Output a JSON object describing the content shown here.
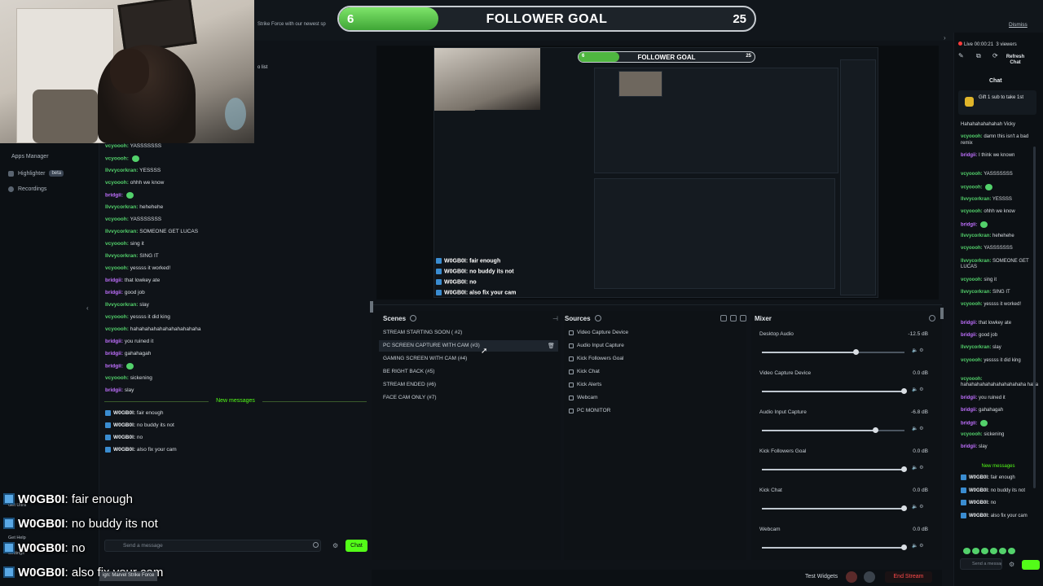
{
  "goal": {
    "current": "6",
    "title": "FOLLOWER GOAL",
    "target": "25",
    "progress": 0.24
  },
  "top": {
    "banner_text": "Strike Force with our newest sp",
    "dismiss": "Dismiss",
    "scene_snippet": "o list"
  },
  "sidebar": {
    "items": [
      {
        "label": "Apps Manager"
      },
      {
        "label": "Highlighter",
        "badge": "beta"
      },
      {
        "label": "Recordings"
      }
    ],
    "bottom_items": [
      "Get Ultra",
      "Get Help",
      "Settings"
    ]
  },
  "left_chat": {
    "lines": [
      {
        "user": "vcyoooh:",
        "text": "YASSSSSSS",
        "color": "green"
      },
      {
        "user": "vcyoooh:",
        "text": "",
        "color": "green",
        "emote": true
      },
      {
        "user": "llvvycorkran:",
        "text": "YESSSS",
        "color": "green"
      },
      {
        "user": "vcyoooh:",
        "text": "ohhh we know",
        "color": "green"
      },
      {
        "user": "bridgii:",
        "text": "",
        "color": "purple",
        "emote": true
      },
      {
        "user": "llvvycorkran:",
        "text": "hehehehe",
        "color": "green"
      },
      {
        "user": "vcyoooh:",
        "text": "YASSSSSSS",
        "color": "green"
      },
      {
        "user": "llvvycorkran:",
        "text": "SOMEONE GET LUCAS",
        "color": "green"
      },
      {
        "user": "vcyoooh:",
        "text": "sing it",
        "color": "green"
      },
      {
        "user": "llvvycorkran:",
        "text": "SING IT",
        "color": "green"
      },
      {
        "user": "vcyoooh:",
        "text": "yessss it worked!",
        "color": "green"
      },
      {
        "user": "bridgii:",
        "text": "that lowkey ate",
        "color": "purple"
      },
      {
        "user": "bridgii:",
        "text": "good job",
        "color": "purple"
      },
      {
        "user": "llvvycorkran:",
        "text": "slay",
        "color": "green"
      },
      {
        "user": "vcyoooh:",
        "text": "yessss it did king",
        "color": "green"
      },
      {
        "user": "vcyoooh:",
        "text": "hahahahahahahahahahahaha",
        "color": "green"
      },
      {
        "user": "bridgii:",
        "text": "you ruined it",
        "color": "purple"
      },
      {
        "user": "bridgii:",
        "text": "gahahagah",
        "color": "purple"
      },
      {
        "user": "bridgii:",
        "text": "",
        "color": "purple",
        "emote": true
      },
      {
        "user": "vcyoooh:",
        "text": "sickening",
        "color": "green"
      },
      {
        "user": "bridgii:",
        "text": "slay",
        "color": "purple"
      }
    ],
    "new_messages_label": "New messages",
    "recent": [
      {
        "user": "W0GB0I:",
        "text": "fair enough"
      },
      {
        "user": "W0GB0I:",
        "text": "no buddy its not"
      },
      {
        "user": "W0GB0I:",
        "text": "no"
      },
      {
        "user": "W0GB0I:",
        "text": "also fix your cam"
      }
    ],
    "input_placeholder": "Send a message",
    "chat_button": "Chat"
  },
  "big_overlay": [
    {
      "user": "W0GB0I",
      "text": ": fair enough"
    },
    {
      "user": "W0GB0I",
      "text": ": no buddy its not"
    },
    {
      "user": "W0GB0I",
      "text": ": no"
    },
    {
      "user": "W0GB0I",
      "text": ": also fix your cam"
    }
  ],
  "tagline": "ign: Marvel Strike Force",
  "preview": {
    "goal_current": "6",
    "goal_title": "FOLLOWER GOAL",
    "goal_target": "25",
    "msgs": [
      {
        "user": "W0GB0I",
        "text": ": fair enough"
      },
      {
        "user": "W0GB0I",
        "text": ": no buddy its not"
      },
      {
        "user": "W0GB0I",
        "text": ": no"
      },
      {
        "user": "W0GB0I",
        "text": ": also fix your cam"
      }
    ]
  },
  "scenes": {
    "title": "Scenes",
    "items": [
      "STREAM STARTING SOON ( #2)",
      "PC SCREEN CAPTURE WITH CAM (#3)",
      "GAMING SCREEN WITH CAM (#4)",
      "BE RIGHT BACK (#5)",
      "STREAM ENDED (#6)",
      "FACE CAM ONLY (#7)"
    ]
  },
  "sources": {
    "title": "Sources",
    "items": [
      "Video Capture Device",
      "Audio Input Capture",
      "Kick Followers Goal",
      "Kick Chat",
      "Kick Alerts",
      "Webcam",
      "PC MONITOR"
    ]
  },
  "mixer": {
    "title": "Mixer",
    "channels": [
      {
        "name": "Desktop Audio",
        "db": "-12.5 dB",
        "level": 0.66
      },
      {
        "name": "Video Capture Device",
        "db": "0.0 dB",
        "level": 1.0
      },
      {
        "name": "Audio Input Capture",
        "db": "-6.8 dB",
        "level": 0.8
      },
      {
        "name": "Kick Followers Goal",
        "db": "0.0 dB",
        "level": 1.0
      },
      {
        "name": "Kick Chat",
        "db": "0.0 dB",
        "level": 1.0
      },
      {
        "name": "Webcam",
        "db": "0.0 dB",
        "level": 1.0
      }
    ]
  },
  "bottom": {
    "test_widgets": "Test Widgets",
    "end_stream": "End Stream"
  },
  "right": {
    "live": "Live 00:00:21",
    "viewers": "3 viewers",
    "refresh_line1": "Refresh",
    "refresh_line2": "Chat",
    "chat_title": "Chat",
    "gift_text": "Gift 1 sub to take 1st",
    "messages": [
      {
        "user": "",
        "text": "Hahahahahahahah Vicky"
      },
      {
        "user": "vcyoooh:",
        "text": "damn this isn't a bad remix"
      },
      {
        "user": "bridgii:",
        "text": "I think we known"
      },
      {
        "user": "vcyoooh:",
        "text": "YASSSSSSS"
      },
      {
        "user": "vcyoooh:",
        "text": ""
      },
      {
        "user": "llvvycorkran:",
        "text": "YESSSS"
      },
      {
        "user": "vcyoooh:",
        "text": "ohhh we know"
      },
      {
        "user": "bridgii:",
        "text": ""
      },
      {
        "user": "llvvycorkran:",
        "text": "hehehehe"
      },
      {
        "user": "vcyoooh:",
        "text": "YASSSSSSS"
      },
      {
        "user": "llvvycorkran:",
        "text": "SOMEONE GET LUCAS"
      },
      {
        "user": "vcyoooh:",
        "text": "sing it"
      },
      {
        "user": "llvvycorkran:",
        "text": "SING IT"
      },
      {
        "user": "vcyoooh:",
        "text": "yessss it worked!"
      },
      {
        "user": "bridgii:",
        "text": "that lowkey ate"
      },
      {
        "user": "bridgii:",
        "text": "good job"
      },
      {
        "user": "llvvycorkran:",
        "text": "slay"
      },
      {
        "user": "vcyoooh:",
        "text": "yessss it did king"
      },
      {
        "user": "vcyoooh:",
        "text": "hahahahahahahahahahahaha haha"
      },
      {
        "user": "bridgii:",
        "text": "you ruined it"
      },
      {
        "user": "bridgii:",
        "text": "gahahagah"
      },
      {
        "user": "bridgii:",
        "text": ""
      },
      {
        "user": "vcyoooh:",
        "text": "sickening"
      },
      {
        "user": "bridgii:",
        "text": "slay"
      }
    ],
    "new_messages": "New messages",
    "recent": [
      {
        "user": "W0GB0I:",
        "text": "fair enough"
      },
      {
        "user": "W0GB0I:",
        "text": "no buddy its not"
      },
      {
        "user": "W0GB0I:",
        "text": "no"
      },
      {
        "user": "W0GB0I:",
        "text": "also fix your cam"
      }
    ],
    "send_placeholder": "Send a message"
  },
  "colors": {
    "kick_green": "#53fc18",
    "end_red": "#ff4a4a",
    "user_green": "#53d16b",
    "user_purple": "#c070ff"
  }
}
